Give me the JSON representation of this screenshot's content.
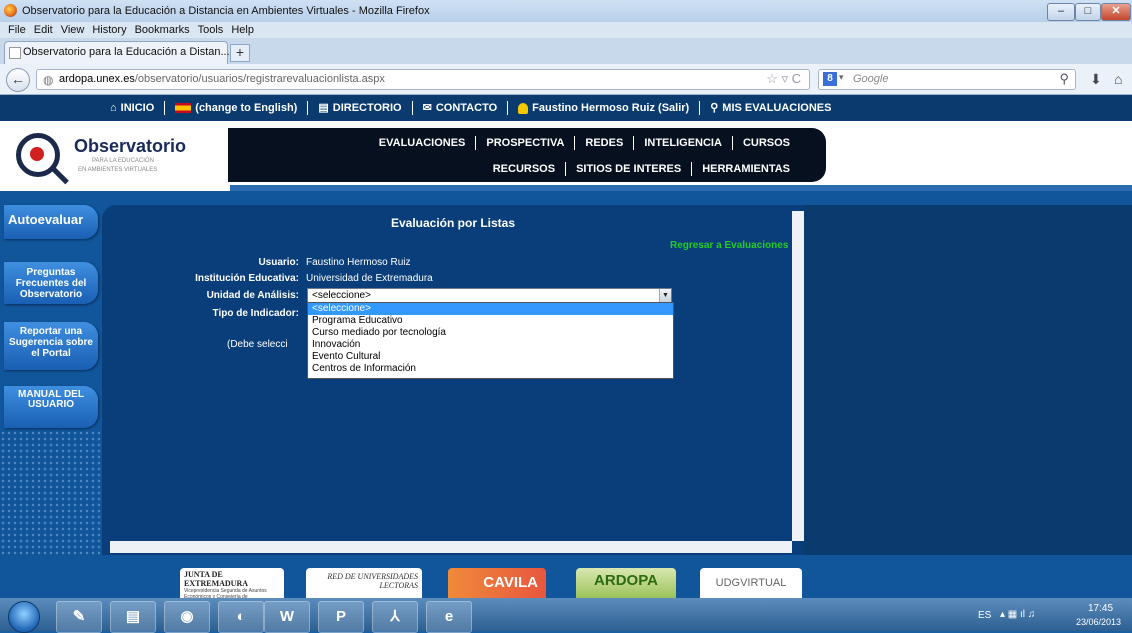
{
  "window": {
    "title": "Observatorio para la Educación a Distancia en Ambientes Virtuales - Mozilla Firefox",
    "min": "–",
    "max": "□",
    "close": "✕"
  },
  "menubar": [
    "File",
    "Edit",
    "View",
    "History",
    "Bookmarks",
    "Tools",
    "Help"
  ],
  "tab": {
    "label": "Observatorio para la Educación a Distan...",
    "new_tab": "+"
  },
  "nav": {
    "back": "←",
    "url_domain": "ardopa.unex.es",
    "url_path": "/observatorio/usuarios/registrarevaluacionlista.aspx",
    "url_prefix": "",
    "star": "☆ ▿ C",
    "search_engine": "8",
    "search_placeholder": "Google",
    "search_icon": "⚲",
    "download": "⬇",
    "home": "⌂"
  },
  "topnav": {
    "inicio": "INICIO",
    "english": "(change to English)",
    "directorio": "DIRECTORIO",
    "contacto": "CONTACTO",
    "user": "Faustino Hermoso Ruiz (Salir)",
    "evaluaciones": "MIS EVALUACIONES"
  },
  "logo": {
    "title": "Observatorio",
    "sub1": "PARA LA EDUCACIÓN",
    "sub2": "EN AMBIENTES VIRTUALES"
  },
  "mainmenu": {
    "row1": [
      "EVALUACIONES",
      "PROSPECTIVA",
      "REDES",
      "INTELIGENCIA",
      "CURSOS"
    ],
    "row2": [
      "RECURSOS",
      "SITIOS DE INTERES",
      "HERRAMIENTAS"
    ]
  },
  "sidebar": [
    "Autoevaluar",
    "Preguntas Frecuentes del Observatorio",
    "Reportar una Sugerencia sobre el Portal",
    "MANUAL DEL USUARIO"
  ],
  "content": {
    "title": "Evaluación por Listas",
    "back_link": "Regresar a Evaluaciones",
    "usuario_label": "Usuario:",
    "usuario_value": "Faustino Hermoso Ruiz",
    "institucion_label": "Institución Educativa:",
    "institucion_value": "Universidad de Extremadura",
    "unidad_label": "Unidad de Análisis:",
    "unidad_value": "<seleccione>",
    "tipo_label": "Tipo de Indicador:",
    "hint": "(Debe selecci",
    "options": [
      "<seleccione>",
      "Programa Educativo",
      "Curso mediado por tecnología",
      "Innovación",
      "Evento Cultural",
      "Centros de Información"
    ]
  },
  "footer": {
    "junta": "JUNTA DE EXTREMADURA",
    "junta_sub": "Vicepresidencia Segunda de Asuntos Económicos y Consejería de",
    "red": "RED DE UNIVERSIDADES LECTORAS",
    "cavila": "CAVILA",
    "ardopa": "ARDOPA",
    "udg": "UDGVIRTUAL"
  },
  "taskbar": {
    "lang": "ES",
    "time": "17:45",
    "date": "23/06/2013"
  }
}
